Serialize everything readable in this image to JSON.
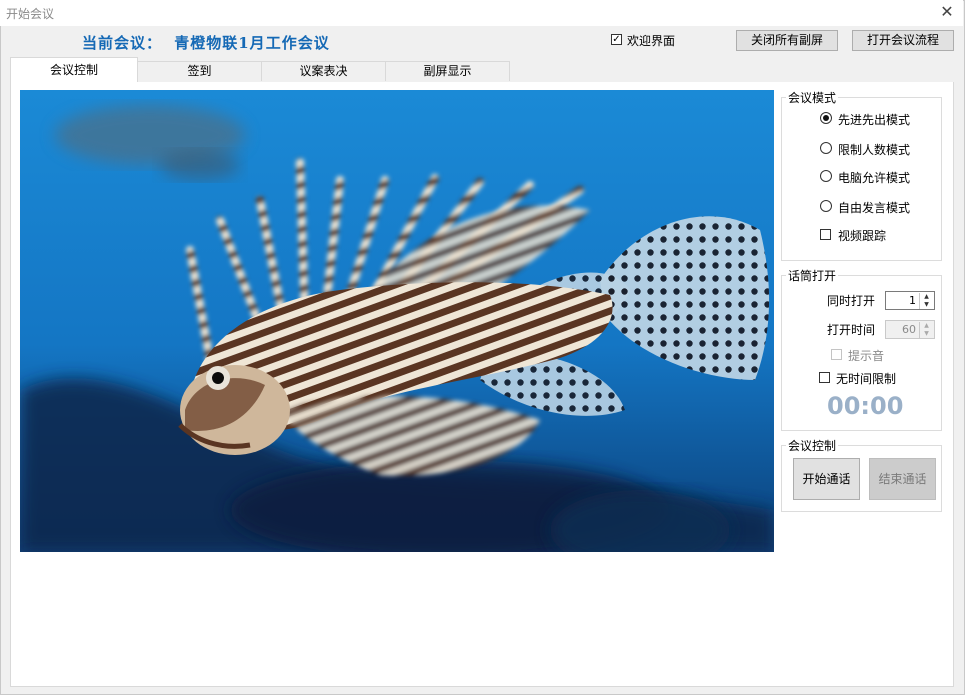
{
  "window": {
    "title": "开始会议",
    "close_glyph": "✕"
  },
  "header": {
    "conference_label": "当前会议：",
    "conference_name": "青橙物联1月工作会议",
    "welcome_checkbox": {
      "label": "欢迎界面",
      "checked": true,
      "check_glyph": "✓"
    },
    "close_all_screens": "关闭所有副屏",
    "open_flow": "打开会议流程"
  },
  "tabs": [
    {
      "label": "会议控制",
      "active": true
    },
    {
      "label": "签到",
      "active": false
    },
    {
      "label": "议案表决",
      "active": false
    },
    {
      "label": "副屏显示",
      "active": false
    }
  ],
  "mode_group": {
    "title": "会议模式",
    "options": [
      {
        "label": "先进先出模式",
        "selected": true
      },
      {
        "label": "限制人数模式",
        "selected": false
      },
      {
        "label": "电脑允许模式",
        "selected": false
      },
      {
        "label": "自由发言模式",
        "selected": false
      }
    ],
    "video_tracking": {
      "label": "视频跟踪",
      "checked": false
    }
  },
  "mic_group": {
    "title": "话筒打开",
    "simultaneous_label": "同时打开",
    "simultaneous_value": "1",
    "open_time_label": "打开时间",
    "open_time_value": "60",
    "beep_label": "提示音",
    "no_limit_label": "无时间限制",
    "timer": "00:00"
  },
  "control_group": {
    "title": "会议控制",
    "start_call": "开始通话",
    "end_call": "结束通话"
  },
  "colors": {
    "accent": "#1569b5",
    "timer": "#9ab0c8",
    "water": "#1a7fd0"
  },
  "spin_glyphs": {
    "up": "▲",
    "down": "▼"
  }
}
